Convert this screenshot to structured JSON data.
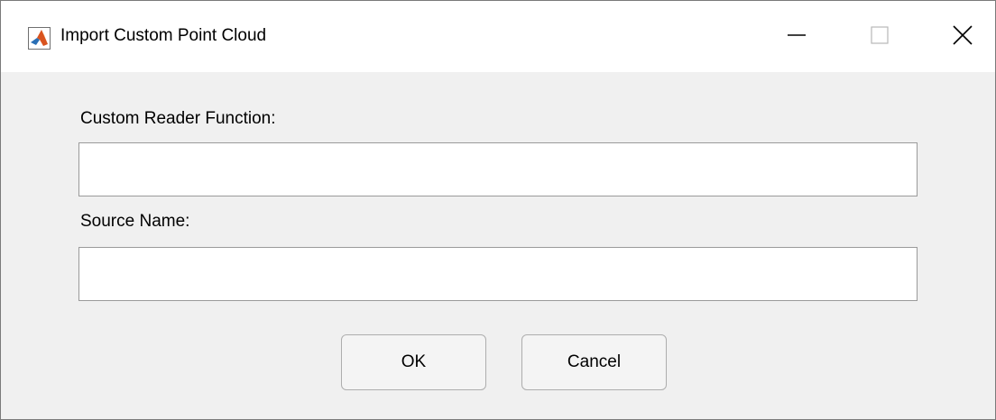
{
  "window": {
    "title": "Import Custom Point Cloud",
    "app_icon": "matlab-logo-icon",
    "controls": {
      "minimize_icon": "minimize-icon",
      "maximize_icon": "maximize-icon",
      "close_icon": "close-icon"
    }
  },
  "form": {
    "reader_label": "Custom Reader Function:",
    "reader_value": "",
    "source_label": "Source Name:",
    "source_value": ""
  },
  "buttons": {
    "ok_label": "OK",
    "cancel_label": "Cancel"
  },
  "colors": {
    "dialog_background": "#f0f0f0",
    "titlebar_background": "#ffffff",
    "field_border": "#9a9a9a",
    "button_border": "#adadad"
  }
}
